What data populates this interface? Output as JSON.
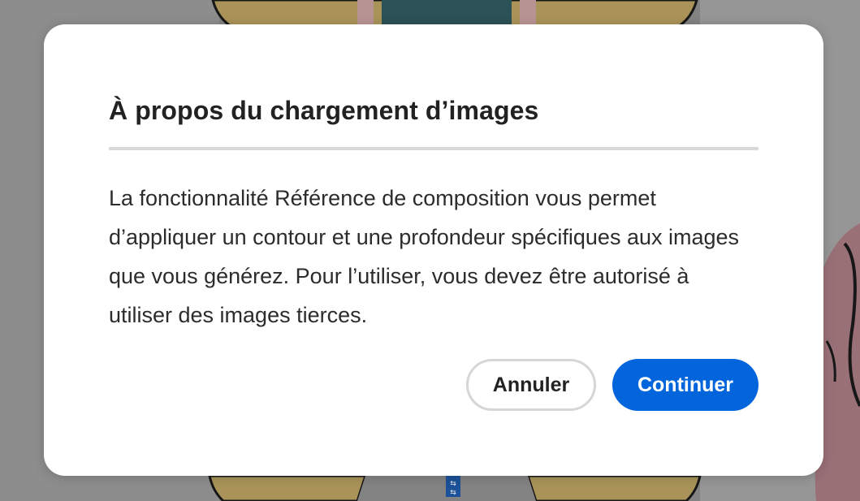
{
  "dialog": {
    "title": "À propos du chargement d’images",
    "body": "La fonctionnalité Référence de composition vous permet d’appliquer un contour et une profondeur spécifiques aux images que vous générez. Pour l’utiliser, vous devez être autorisé à utiliser des images tierces.",
    "cancel_label": "Annuler",
    "continue_label": "Continuer"
  },
  "colors": {
    "primary_button": "#0265dc",
    "dialog_background": "#ffffff",
    "backdrop": "#8f8f8f"
  }
}
